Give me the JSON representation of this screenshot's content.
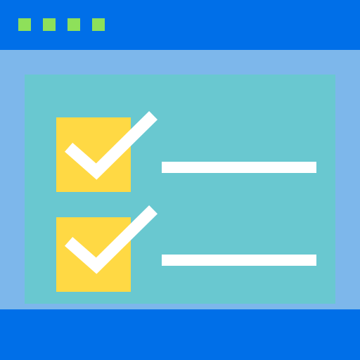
{
  "colors": {
    "titlebar": "#006FE8",
    "body": "#7DB7EB",
    "panel": "#69C8D0",
    "dot": "#8EE05A",
    "checkbox": "#FFD944",
    "check": "#FFFFFF",
    "line": "#FFFFFF",
    "footer": "#006FE8"
  },
  "window": {
    "dots": [
      {
        "icon": "window-dot-icon"
      },
      {
        "icon": "window-dot-icon"
      },
      {
        "icon": "window-dot-icon"
      },
      {
        "icon": "window-dot-icon"
      }
    ]
  },
  "checklist": {
    "items": [
      {
        "checked": true,
        "icon": "checkmark-icon"
      },
      {
        "checked": true,
        "icon": "checkmark-icon"
      }
    ]
  }
}
